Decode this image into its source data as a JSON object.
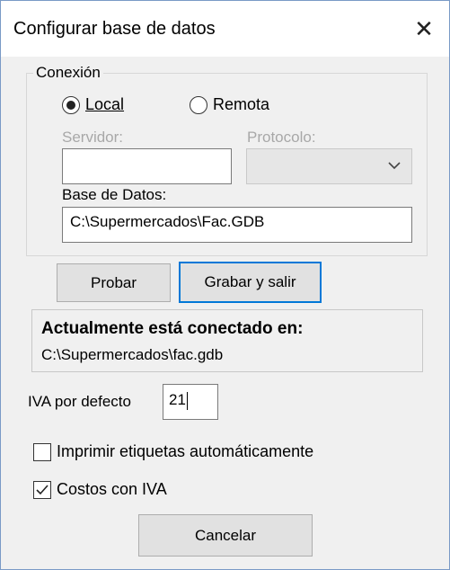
{
  "window": {
    "title": "Configurar base de datos",
    "close_glyph": "✕"
  },
  "connection": {
    "group_label": "Conexión",
    "radio_local": {
      "label": "Local",
      "selected": true
    },
    "radio_remote": {
      "label": "Remota",
      "selected": false
    },
    "server_label": "Servidor:",
    "server_value": "",
    "protocol_label": "Protocolo:",
    "protocol_value": "",
    "database_label": "Base de Datos:",
    "database_value": "C:\\Supermercados\\Fac.GDB"
  },
  "buttons": {
    "test_label": "Probar",
    "save_exit_label": "Grabar y salir",
    "cancel_label": "Cancelar"
  },
  "status": {
    "heading": "Actualmente está conectado en:",
    "path": "C:\\Supermercados\\fac.gdb"
  },
  "vat": {
    "label": "IVA por defecto",
    "value": "21"
  },
  "options": {
    "print_labels": {
      "label": "Imprimir etiquetas automáticamente",
      "checked": false
    },
    "costs_with_vat": {
      "label": "Costos con IVA",
      "checked": true
    }
  },
  "colors": {
    "focus_border": "#0078d7",
    "disabled_text": "#a8a8a8",
    "window_bg": "#f0f0f0"
  }
}
